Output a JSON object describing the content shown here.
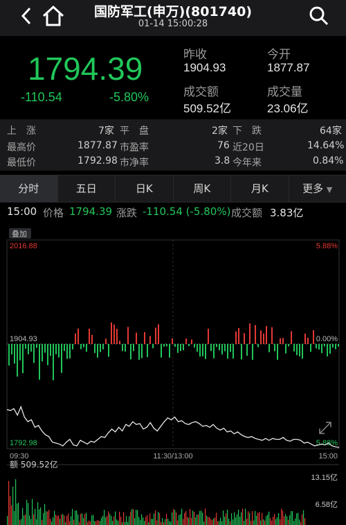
{
  "header": {
    "title": "国防军工(申万)(801740)",
    "datetime": "01-14 15:00:28"
  },
  "quote": {
    "price": "1794.39",
    "change": "-110.54",
    "change_pct": "-5.80%",
    "prev_close_label": "昨收",
    "prev_close": "1904.93",
    "open_label": "今开",
    "open": "1877.87",
    "turnover_label": "成交额",
    "turnover": "509.52亿",
    "volume_label": "成交量",
    "volume": "23.06亿"
  },
  "stats": {
    "rise_label": "上　涨",
    "rise": "7家",
    "flat_label": "平　盘",
    "flat": "2家",
    "fall_label": "下　跌",
    "fall": "64家",
    "high_label": "最高价",
    "high": "1877.87",
    "pe_label": "市盈率",
    "pe": "76",
    "d20_label": "近20日",
    "d20": "14.64%",
    "low_label": "最低价",
    "low": "1792.98",
    "pb_label": "市净率",
    "pb": "3.8",
    "ytd_label": "今年来",
    "ytd": "0.84%"
  },
  "tabs": [
    {
      "label": "分时"
    },
    {
      "label": "五日"
    },
    {
      "label": "日K"
    },
    {
      "label": "周K"
    },
    {
      "label": "月K"
    },
    {
      "label": "更多"
    }
  ],
  "info": {
    "time": "15:00",
    "price_label": "价格",
    "price": "1794.39",
    "change_label": "涨跌",
    "change": "-110.54 (-5.80%)",
    "turnover_label": "成交额",
    "turnover": "3.83亿"
  },
  "chart_overlay_label": "叠加",
  "colors": {
    "up": "#e53935",
    "down": "#21c65a",
    "bg": "#000000",
    "panel": "#1a1a1c"
  },
  "chart_data": {
    "type": "line",
    "x_ticks": [
      "09:30",
      "11:30/13:00",
      "15:00"
    ],
    "y_left": {
      "top": "2016.88",
      "mid": "1904.93",
      "bottom": "1792.98"
    },
    "y_right": {
      "top": "5.88%",
      "mid": "0.00%",
      "bottom": "5.88%"
    },
    "prev_close": 1904.93,
    "ylim": [
      1792.98,
      2016.88
    ],
    "price_series": [
      1835,
      1834,
      1836,
      1829,
      1838,
      1827,
      1822,
      1824,
      1816,
      1818,
      1812,
      1808,
      1806,
      1800,
      1799,
      1798,
      1796,
      1800,
      1803,
      1797,
      1796,
      1802,
      1800,
      1798,
      1801,
      1800,
      1803,
      1806,
      1805,
      1810,
      1814,
      1811,
      1816,
      1812,
      1819,
      1817,
      1822,
      1819,
      1820,
      1814,
      1816,
      1821,
      1815,
      1812,
      1817,
      1822,
      1826,
      1824,
      1827,
      1822,
      1823,
      1820,
      1819,
      1821,
      1822,
      1820,
      1817,
      1818,
      1816,
      1819,
      1815,
      1813,
      1815,
      1811,
      1812,
      1809,
      1811,
      1808,
      1806,
      1805,
      1806,
      1804,
      1803,
      1802,
      1804,
      1802,
      1804,
      1803,
      1803,
      1805,
      1802,
      1801,
      1803,
      1803,
      1802,
      1799,
      1800,
      1798,
      1796,
      1797,
      1798,
      1797,
      1799,
      1796,
      1795,
      1794.39
    ],
    "volume_label": "额",
    "volume_total": "509.52亿",
    "volume_ticks": [
      "13.15亿",
      "6.58亿"
    ]
  }
}
